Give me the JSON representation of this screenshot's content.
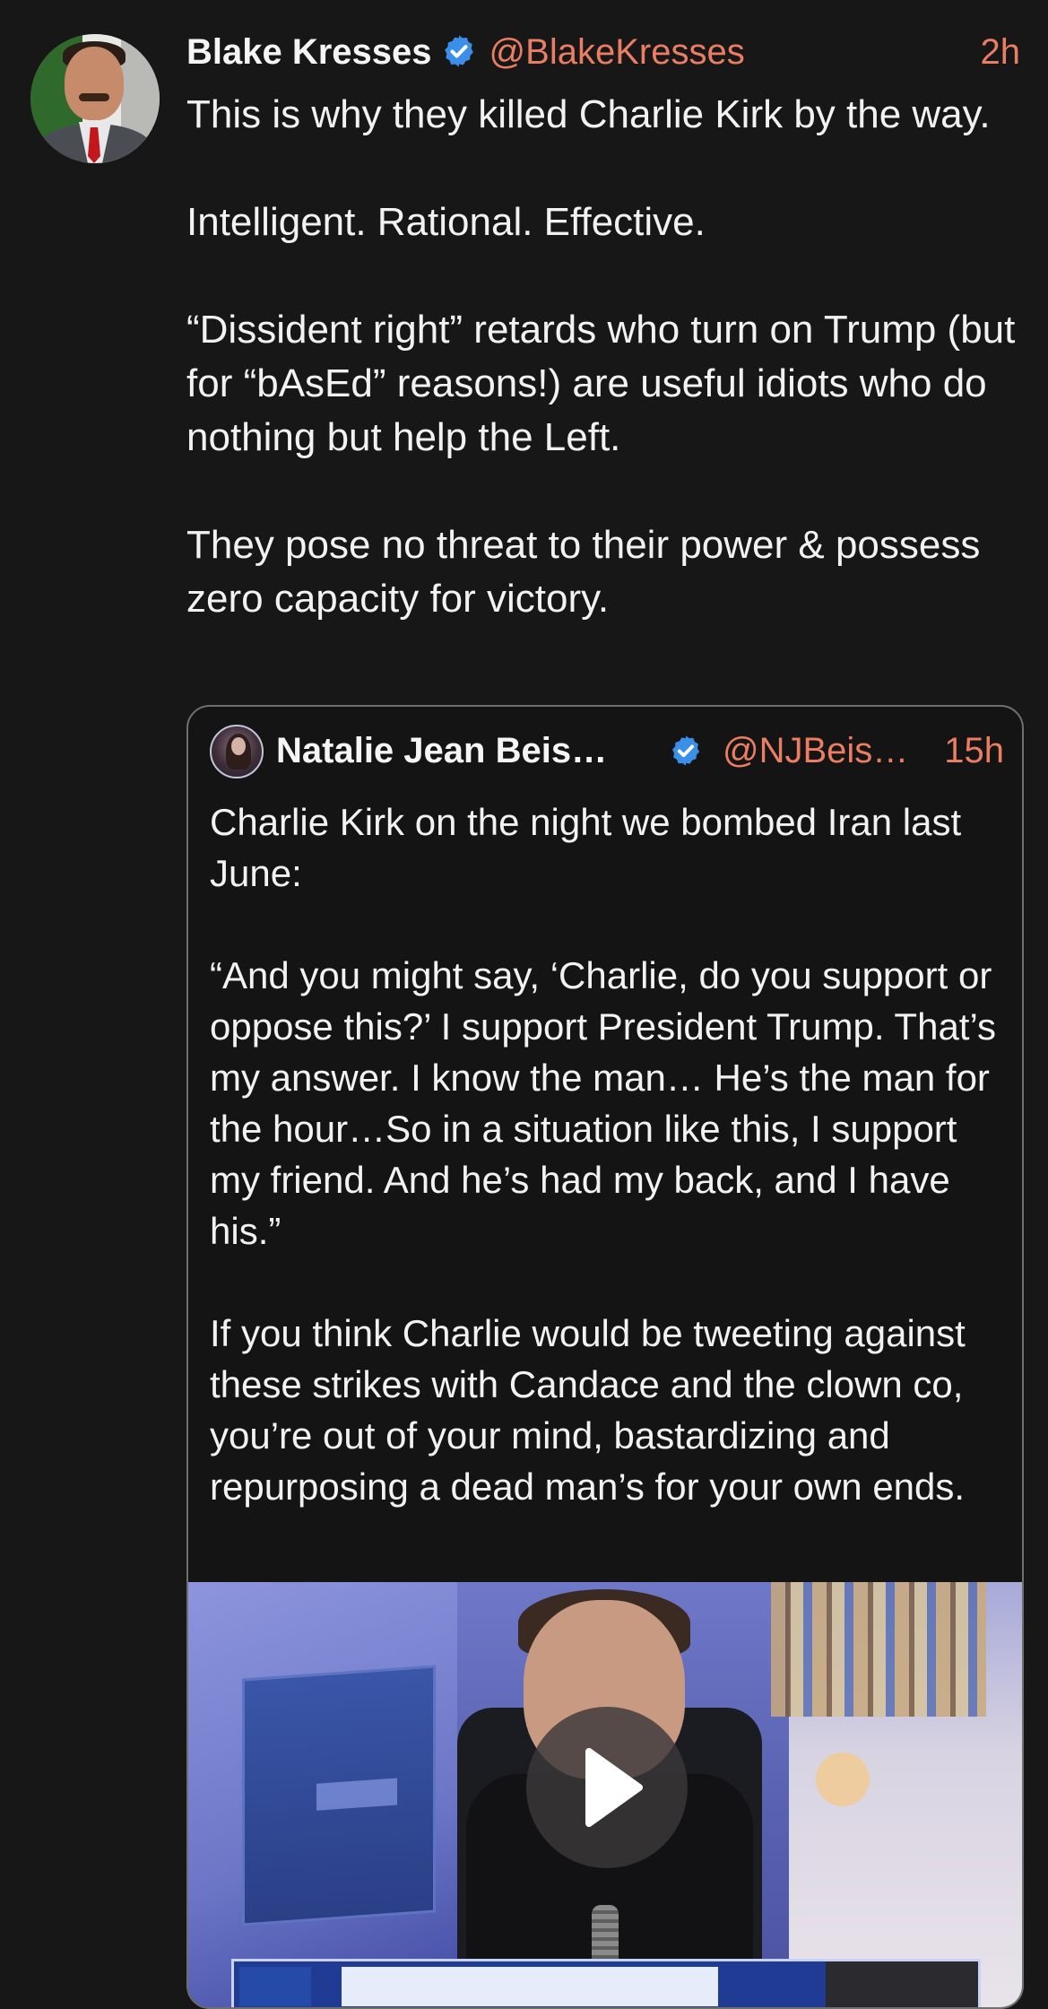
{
  "tweet": {
    "author_name": "Blake Kresses",
    "author_handle": "@BlakeKresses",
    "timestamp": "2h",
    "body": [
      "This is why they killed Charlie Kirk by the way.",
      "Intelligent. Rational. Effective.",
      "“Dissident right” retards who turn on Trump (but for “bAsEd” reasons!) are useful idiots who do nothing but help the Left.",
      "They pose no threat to their power & possess zero capacity for victory."
    ]
  },
  "quoted_tweet": {
    "author_name": "Natalie Jean Beis…",
    "author_handle": "@NJBeis…",
    "timestamp": "15h",
    "body": [
      "Charlie Kirk on the night we bombed Iran last June:",
      "“And you might say, ‘Charlie, do you support or oppose this?’ I support President Trump. That’s my answer. I know the man… He’s the man for the hour…So in a situation like this, I support my friend. And he’s had my back, and I have his.”",
      "If you think Charlie would be tweeting against these strikes with Candace and the clown co, you’re out of your mind, bastardizing and repurposing a dead man’s for your own ends."
    ],
    "media": {
      "type": "video",
      "play_icon": "play-icon"
    }
  },
  "colors": {
    "background": "#171717",
    "text": "#f2f2f2",
    "handle_accent": "#ea7d62",
    "verified_badge": "#3b8fe8",
    "card_border": "#6f6f6f"
  },
  "icons": {
    "verified": "verified-badge-icon",
    "play": "play-icon"
  }
}
